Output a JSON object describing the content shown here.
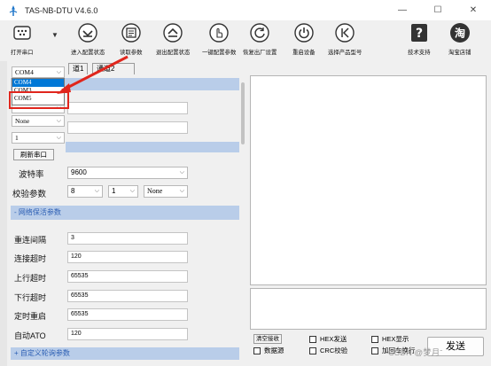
{
  "window": {
    "title": "TAS-NB-DTU V4.6.0",
    "minimize": "—",
    "maximize": "☐",
    "close": "✕"
  },
  "toolbar": [
    {
      "label": "打开串口",
      "icon": "serial-port-icon"
    },
    {
      "label": "进入配置状态",
      "icon": "enter-config-icon"
    },
    {
      "label": "读取参数",
      "icon": "read-params-icon"
    },
    {
      "label": "退出配置状态",
      "icon": "exit-config-icon"
    },
    {
      "label": "一键配置参数",
      "icon": "hand-pointer-icon"
    },
    {
      "label": "恢复出厂设置",
      "icon": "restore-factory-icon"
    },
    {
      "label": "重启设备",
      "icon": "power-icon"
    },
    {
      "label": "选择产品型号",
      "icon": "select-model-icon"
    },
    {
      "label": "技术支持",
      "icon": "help-icon"
    },
    {
      "label": "淘宝店铺",
      "icon": "taobao-icon"
    }
  ],
  "port": {
    "selected": "COM4",
    "options": [
      "COM4",
      "COM3",
      "COM5"
    ],
    "highlighted": "COM4"
  },
  "tabs": [
    "道1",
    "道2"
  ],
  "tab_prefix": "通",
  "serial": {
    "stopbits_value": "",
    "parity_value": "None",
    "databits_value": "1",
    "refresh_label": "刷新串口",
    "baud_label": "波特率",
    "baud_value": "9600",
    "check_label": "校验参数",
    "check_values": [
      "8",
      "1",
      "None"
    ]
  },
  "sections": {
    "network": "- 网络保活参数",
    "custom": "+ 自定义轮询参数"
  },
  "network_rows": [
    {
      "label": "重连间隔",
      "value": "3"
    },
    {
      "label": "连接超时",
      "value": "120"
    },
    {
      "label": "上行超时",
      "value": "65535"
    },
    {
      "label": "下行超时",
      "value": "65535"
    },
    {
      "label": "定时重启",
      "value": "65535"
    },
    {
      "label": "自动ATO",
      "value": "120"
    }
  ],
  "bottom": {
    "clear_recv": "清空接收",
    "data_source": "数据源",
    "hex_send": "HEX发送",
    "crc_check": "CRC校验",
    "hex_display": "HEX显示",
    "add_newline": "加回车换行",
    "send": "发送"
  },
  "watermark": "CSDN @梦月ˉ",
  "colors": {
    "section_bg": "#b9cde9",
    "section_text": "#2a5db3",
    "highlight": "#0078d7",
    "annotation": "#e0261d"
  }
}
